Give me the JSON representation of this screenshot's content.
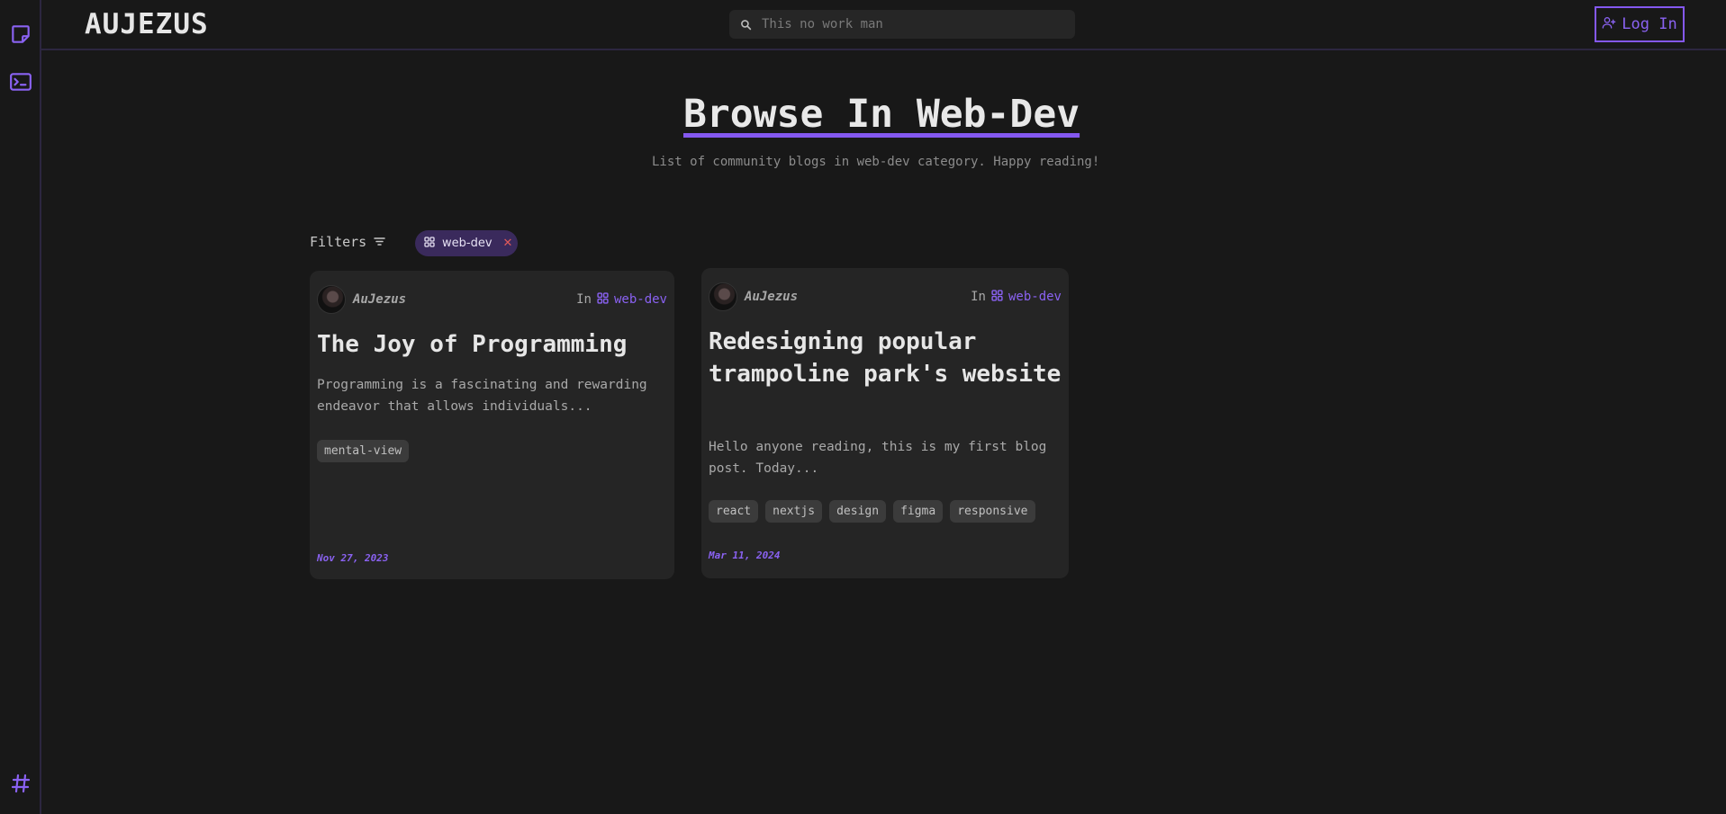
{
  "app": {
    "logo": "AUJEZUS"
  },
  "sidebar": {
    "items": [
      {
        "icon": "sticky-note-icon"
      },
      {
        "icon": "terminal-icon"
      },
      {
        "icon": "hash-icon"
      }
    ]
  },
  "header": {
    "search_placeholder": "This no work man",
    "login_label": "Log In"
  },
  "main": {
    "title": "Browse In Web-Dev",
    "subtitle": "List of community blogs in web-dev category. Happy reading!",
    "filters_label": "Filters",
    "active_filter": "web-dev"
  },
  "posts": [
    {
      "author": "AuJezus",
      "in_label": "In",
      "category": "web-dev",
      "title": "The Joy of Programming",
      "excerpt": "Programming is a fascinating and rewarding endeavor that allows individuals...",
      "tags": [
        "mental-view"
      ],
      "date": "Nov 27, 2023"
    },
    {
      "author": "AuJezus",
      "in_label": "In",
      "category": "web-dev",
      "title": "Redesigning popular trampoline park's website",
      "excerpt": "Hello anyone reading, this is my first blog post. Today...",
      "tags": [
        "react",
        "nextjs",
        "design",
        "figma",
        "responsive"
      ],
      "date": "Mar 11, 2024"
    }
  ],
  "colors": {
    "background": "#181818",
    "card": "#252525",
    "accent": "#8458f0",
    "chip": "#3a2a5c"
  }
}
